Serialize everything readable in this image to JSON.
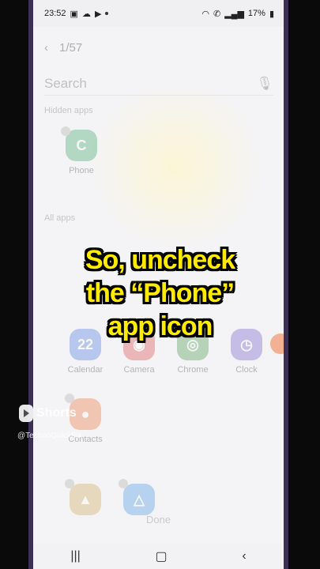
{
  "status": {
    "time": "23:52",
    "battery": "17%"
  },
  "header": {
    "counter": "1/57"
  },
  "search": {
    "placeholder": "Search"
  },
  "sections": {
    "hidden": "Hidden apps",
    "all": "All apps"
  },
  "hidden_apps": [
    {
      "label": "Phone",
      "icon": "phone-icon",
      "color": "#2e9e5a"
    }
  ],
  "all_apps_row1": [
    {
      "label": "Calendar",
      "icon": "calendar-icon",
      "color": "#3d6fe0"
    },
    {
      "label": "Camera",
      "icon": "camera-icon",
      "color": "#d83a3a"
    },
    {
      "label": "Chrome",
      "icon": "chrome-icon",
      "color": "#3c8f3c"
    },
    {
      "label": "Clock",
      "icon": "clock-icon",
      "color": "#6a4fc8"
    }
  ],
  "all_apps_row2": [
    {
      "label": "Contacts",
      "icon": "contacts-icon",
      "color": "#e86a2e"
    }
  ],
  "footer": {
    "done": "Done"
  },
  "caption": {
    "line1": "So, uncheck",
    "line2": "the “Phone”",
    "line3": "app icon"
  },
  "watermark": {
    "shorts": "Shorts",
    "handle": "@TechnoQuickFix"
  },
  "colors": {
    "caption": "#ffeb00",
    "frame": "#3b2f55"
  }
}
